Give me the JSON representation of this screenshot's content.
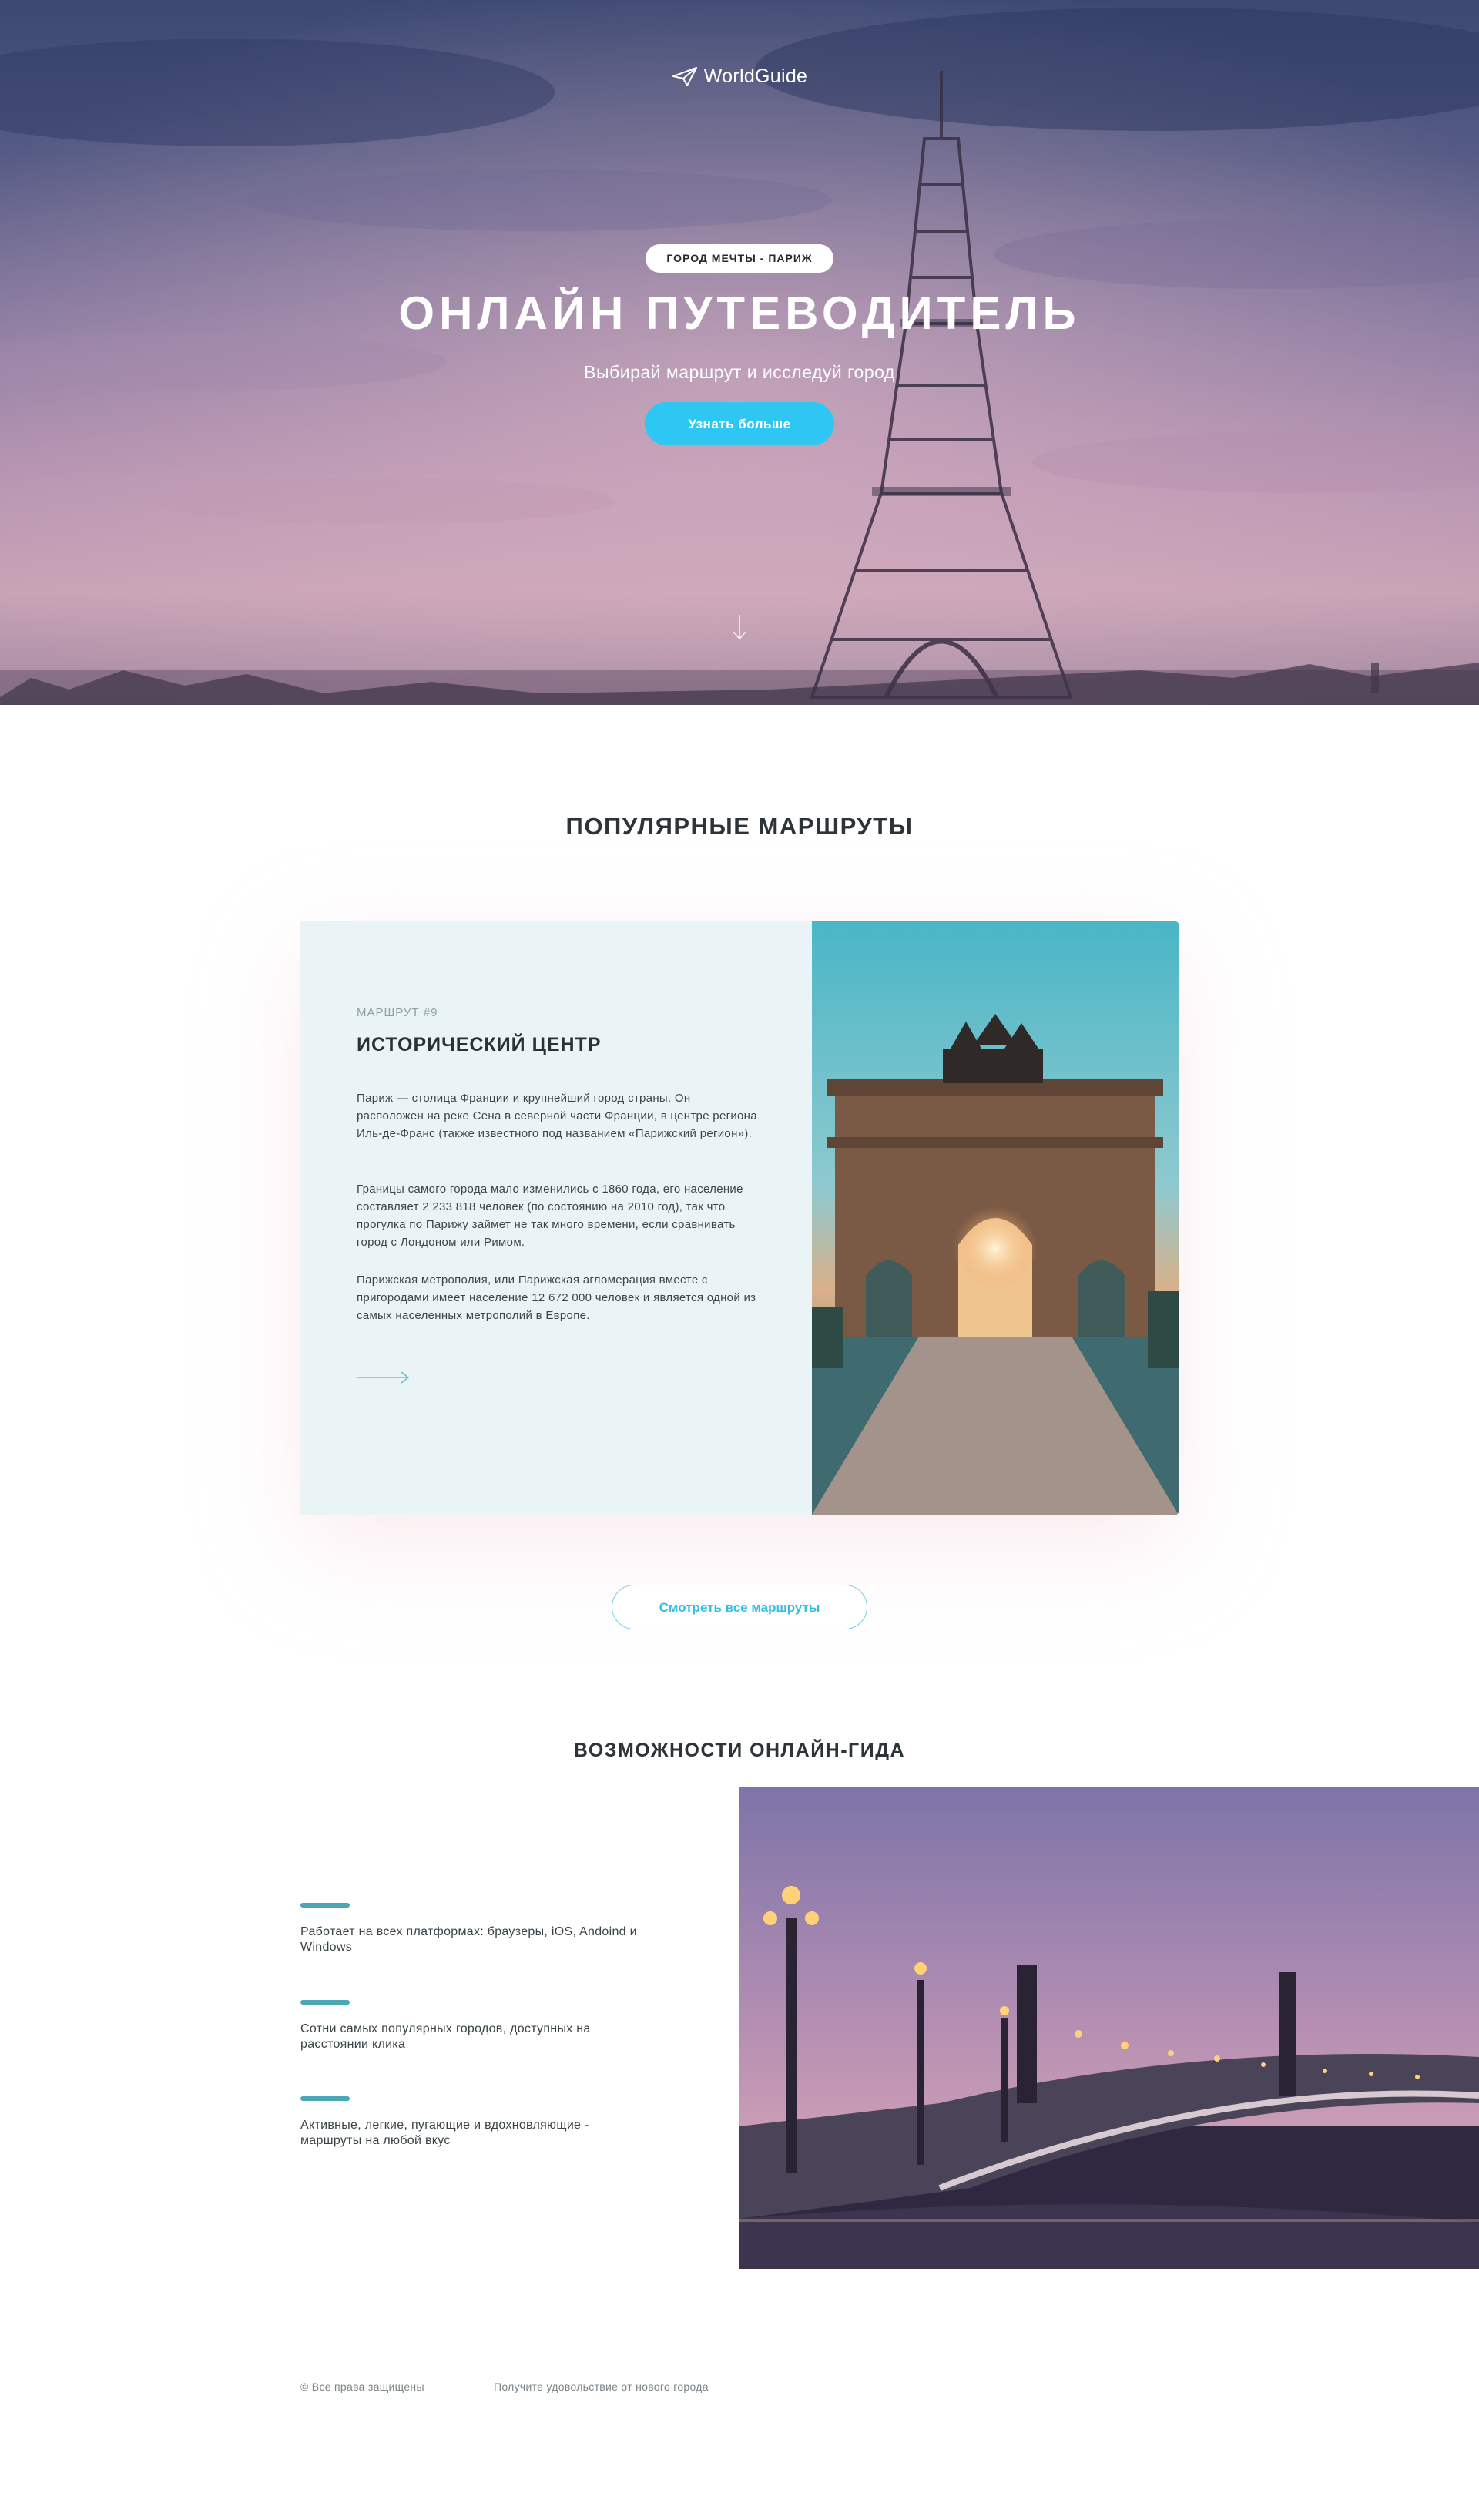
{
  "header": {
    "logo_text": "WorldGuide",
    "logo_icon": "plane-icon"
  },
  "hero": {
    "badge": "ГОРОД МЕЧТЫ - ПАРИЖ",
    "title": "ОНЛАЙН ПУТЕВОДИТЕЛЬ",
    "subtitle": "Выбирай маршрут и исследуй город",
    "cta_label": "Узнать больше",
    "scroll_icon": "arrow-down-icon"
  },
  "routes": {
    "section_title": "ПОПУЛЯРНЫЕ МАРШРУТЫ",
    "card": {
      "kicker": "МАРШРУТ #9",
      "title": "ИСТОРИЧЕСКИЙ ЦЕНТР",
      "paragraphs": [
        "Париж — столица Франции и крупнейший город страны. Он расположен на реке Сена в северной части Франции, в центре региона Иль-де-Франс (также известного под названием «Парижский регион»).",
        "Границы самого города мало изменились с 1860 года, его население составляет 2 233 818 человек (по состоянию на 2010 год), так что прогулка по Парижу займет не так много времени, если сравнивать город с Лондоном или Римом.",
        "Парижская метрополия, или Парижская агломерация вместе с пригородами имеет население 12 672 000 человек и является одной из самых населенных метрополий в Европе."
      ],
      "arrow_icon": "arrow-right-icon"
    },
    "all_routes_label": "Смотреть все маршруты"
  },
  "features": {
    "section_title": "ВОЗМОЖНОСТИ ОНЛАЙН-ГИДА",
    "items": [
      {
        "text": "Работает на всех платформах: браузеры, iOS, Andoind и Windows"
      },
      {
        "text": "Сотни самых популярных городов, доступных на расстоянии клика"
      },
      {
        "text": "Активные, легкие, пугающие и вдохновляющие - маршруты на любой вкус"
      }
    ]
  },
  "footer": {
    "copyright": "© Все права защищены",
    "tagline": "Получите удовольствие от нового города"
  },
  "colors": {
    "accent": "#2ec7f3",
    "feature_bar": "#4aa8b5",
    "card_bg": "#eaf3f5",
    "text_dark": "#2b3236"
  }
}
